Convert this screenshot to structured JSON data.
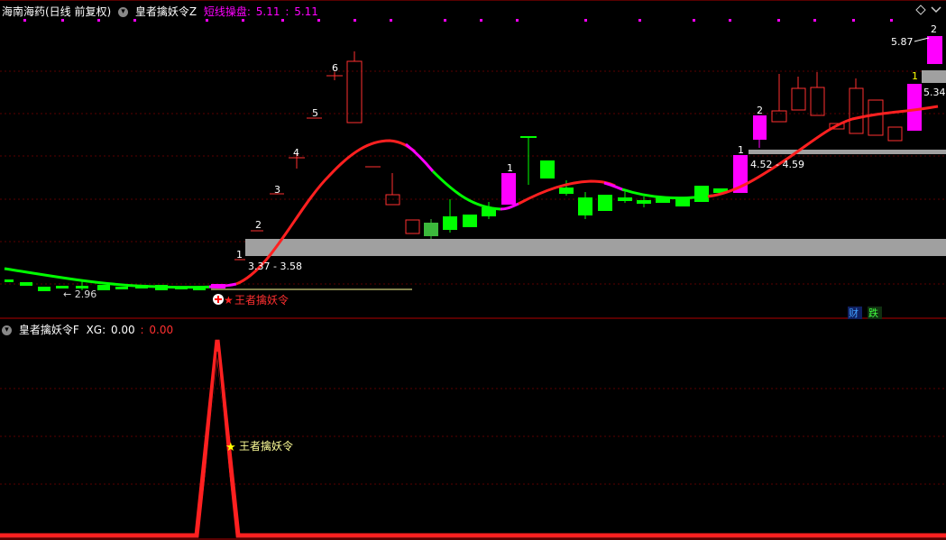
{
  "main_panel": {
    "stock_title": "海南海药(日线 前复权)",
    "indicator_name": "皇者擒妖令Z",
    "indicator_label": "短线操盘:",
    "indicator_v1": "5.11",
    "indicator_sep": ":",
    "indicator_v2": "5.11",
    "price_low_label": "← 2.96",
    "zone1_label": "3.37 - 3.58",
    "zone2_label": "4.52 - 4.59",
    "high_label": "5.87",
    "last_label": "5.34",
    "signal_label": "王者擒妖令",
    "badge_cai": "财",
    "badge_die": "跌",
    "count_labels_left": [
      "1",
      "2",
      "3",
      "4",
      "5",
      "6"
    ],
    "count_labels_right": [
      "1",
      "1",
      "2",
      "1",
      "2"
    ]
  },
  "sub_panel": {
    "indicator_name": "皇者擒妖令F",
    "xg_label": "XG:",
    "xg_v1": "0.00",
    "xg_sep": ":",
    "xg_v2": "0.00",
    "signal_label": "王者擒妖令"
  },
  "colors": {
    "up": "#ff3030",
    "down": "#00ff00",
    "magenta": "#ff00ff",
    "zone": "#a0a0a0",
    "grid": "#5a0000",
    "yellow": "#ffff00"
  },
  "icons": [
    "chevron-down-icon",
    "diamond-icon",
    "chevron-down-icon",
    "plus-circle-icon",
    "star-icon"
  ]
}
